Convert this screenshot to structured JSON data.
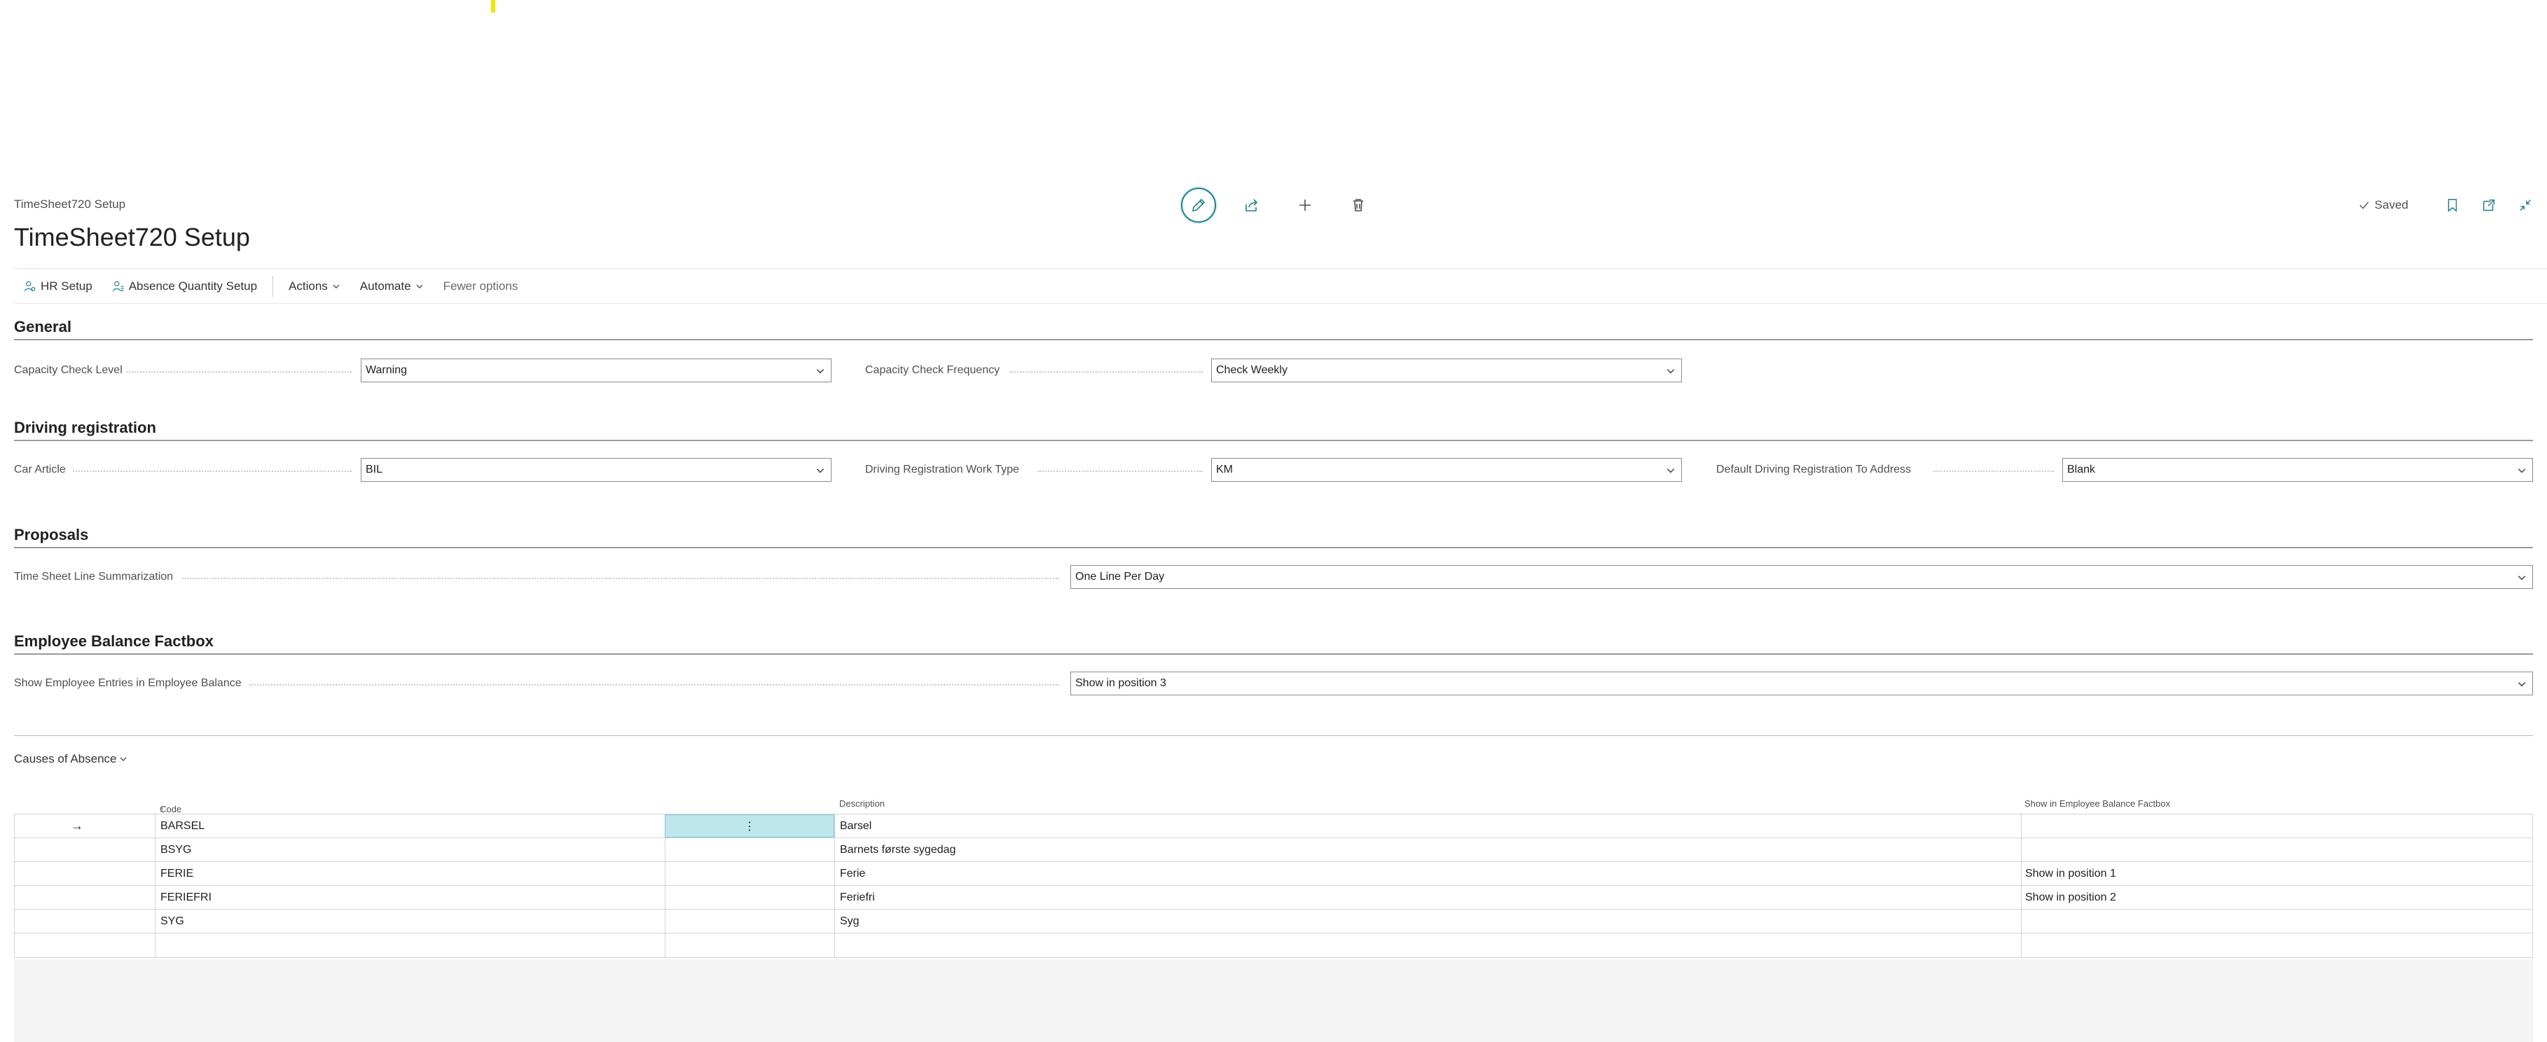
{
  "header": {
    "breadcrumb": "TimeSheet720 Setup",
    "title": "TimeSheet720 Setup",
    "status": "Saved"
  },
  "icons": {
    "edit": "pencil-icon",
    "share": "share-icon",
    "new": "plus-icon",
    "delete": "trash-icon",
    "saved": "check-icon",
    "bookmark": "bookmark-icon",
    "open_new": "open-in-new-window-icon",
    "collapse": "collapse-icon"
  },
  "actions": {
    "hr_setup": "HR Setup",
    "absence_quantity_setup": "Absence Quantity Setup",
    "actions": "Actions",
    "automate": "Automate",
    "fewer_options": "Fewer options"
  },
  "general": {
    "title": "General",
    "capacity_check_level_label": "Capacity Check Level",
    "capacity_check_level_value": "Warning",
    "capacity_check_frequency_label": "Capacity Check Frequency",
    "capacity_check_frequency_value": "Check Weekly"
  },
  "driving": {
    "title": "Driving registration",
    "car_article_label": "Car Article",
    "car_article_value": "BIL",
    "work_type_label": "Driving Registration Work Type",
    "work_type_value": "KM",
    "default_address_label": "Default Driving Registration To Address",
    "default_address_value": "Blank"
  },
  "proposals": {
    "title": "Proposals",
    "summarization_label": "Time Sheet Line Summarization",
    "summarization_value": "One Line Per Day"
  },
  "balance": {
    "title": "Employee Balance Factbox",
    "show_entries_label": "Show Employee Entries in Employee Balance",
    "show_entries_value": "Show in position 3"
  },
  "causes": {
    "title": "Causes of Absence",
    "columns": {
      "code": "Code",
      "description": "Description",
      "show_in_factbox": "Show in Employee Balance Factbox"
    },
    "rows": [
      {
        "code": "BARSEL",
        "description": "Barsel",
        "show": ""
      },
      {
        "code": "BSYG",
        "description": "Barnets første sygedag",
        "show": ""
      },
      {
        "code": "FERIE",
        "description": "Ferie",
        "show": "Show in position 1"
      },
      {
        "code": "FERIEFRI",
        "description": "Feriefri",
        "show": "Show in position 2"
      },
      {
        "code": "SYG",
        "description": "Syg",
        "show": ""
      }
    ],
    "row_indicator": "→",
    "row_menu": "⋮",
    "sort_indicator": "↑"
  },
  "colors": {
    "accent": "#1f7f8c",
    "selected_cell": "#bfe6ec",
    "env_marker": "#f2e500"
  }
}
